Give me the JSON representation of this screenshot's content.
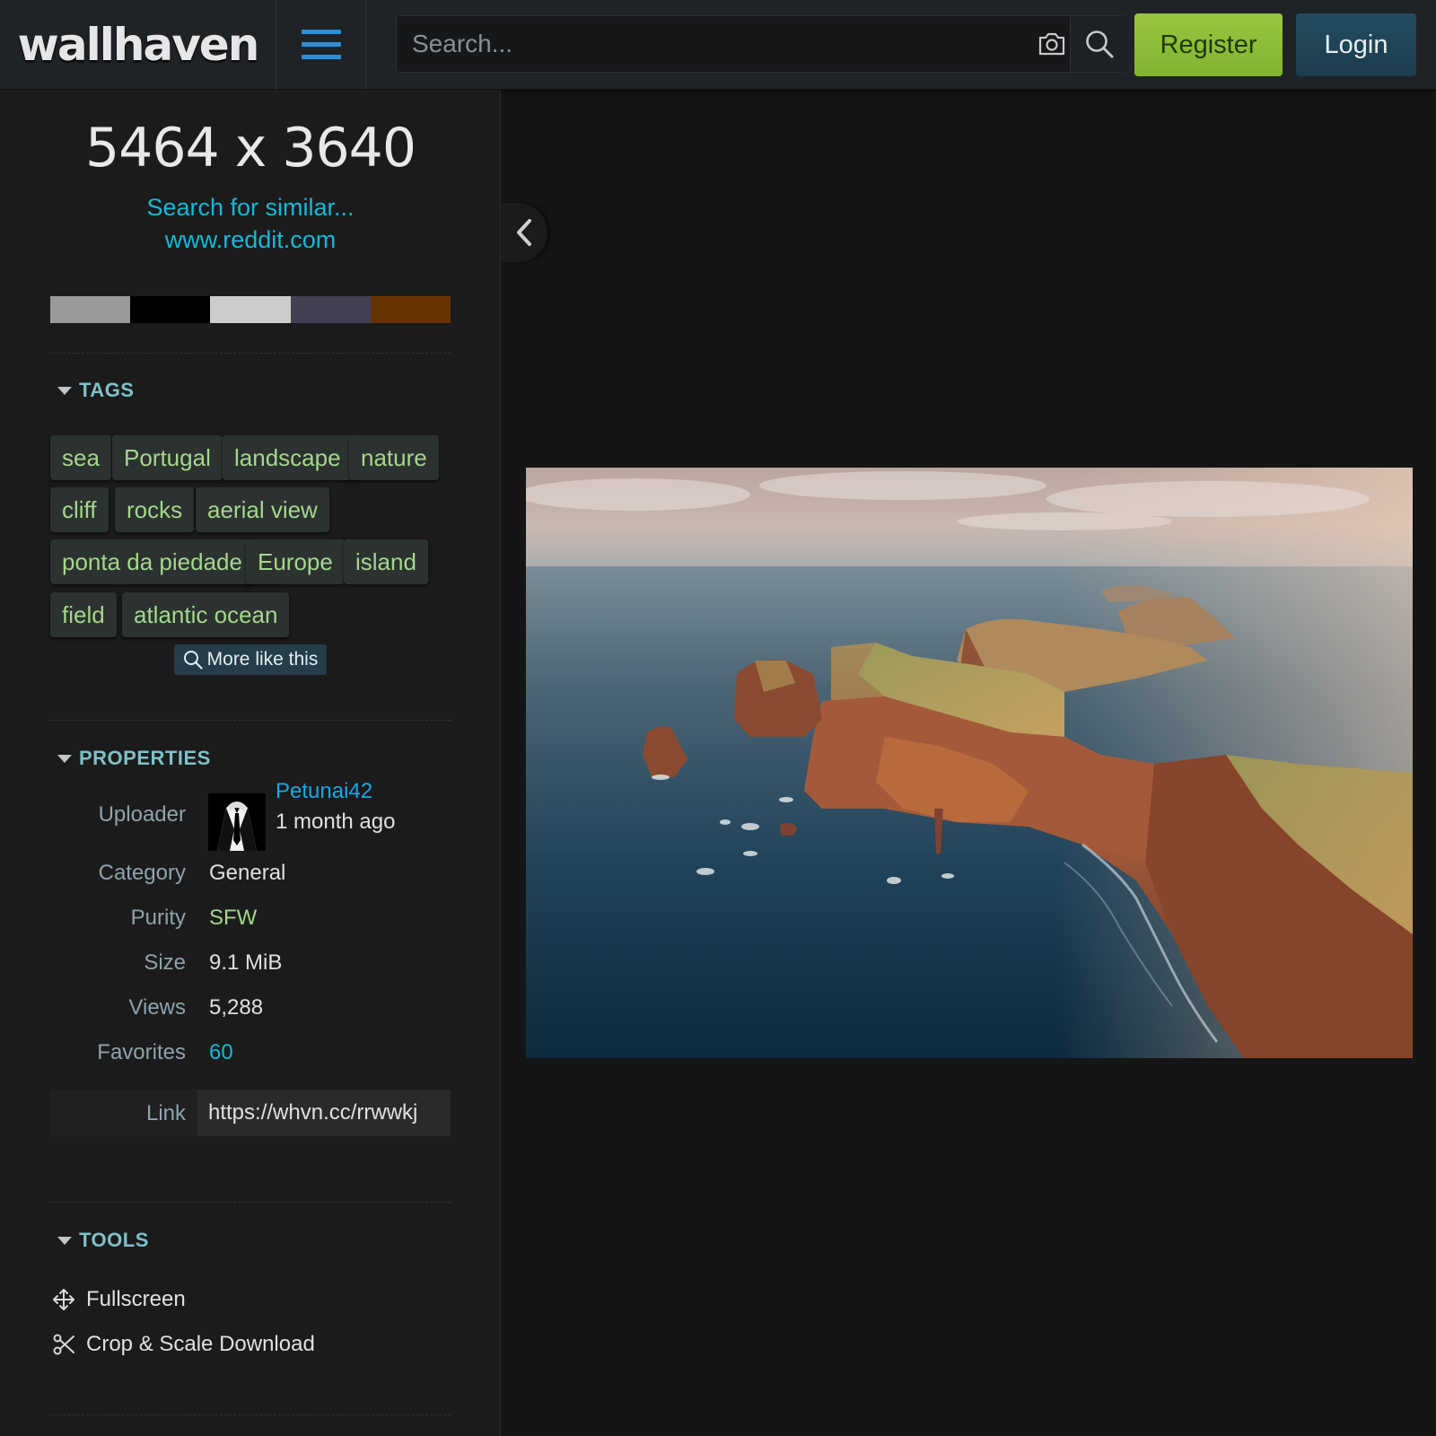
{
  "header": {
    "logo_text": "wallhaven",
    "search_placeholder": "Search...",
    "register_label": "Register",
    "login_label": "Login"
  },
  "sidebar": {
    "resolution": "5464 x 3640",
    "search_similar": "Search for similar...",
    "source_link": "www.reddit.com",
    "palette": [
      "#999999",
      "#000000",
      "#cccccc",
      "#424153",
      "#663300"
    ],
    "tags_title": "TAGS",
    "tags": [
      "sea",
      "Portugal",
      "landscape",
      "nature",
      "cliff",
      "rocks",
      "aerial view",
      "ponta da piedade",
      "Europe",
      "island",
      "field",
      "atlantic ocean"
    ],
    "more_like_this": "More like this",
    "properties_title": "PROPERTIES",
    "properties": {
      "uploader_label": "Uploader",
      "uploader_name": "Petunai42",
      "uploaded": "1 month ago",
      "category_label": "Category",
      "category": "General",
      "purity_label": "Purity",
      "purity": "SFW",
      "size_label": "Size",
      "size": "9.1 MiB",
      "views_label": "Views",
      "views": "5,288",
      "favorites_label": "Favorites",
      "favorites": "60",
      "link_label": "Link",
      "link": "https://whvn.cc/rrwwkj"
    },
    "tools_title": "TOOLS",
    "tools": {
      "fullscreen": "Fullscreen",
      "crop": "Crop & Scale Download"
    }
  },
  "colors": {
    "accent_link": "#13b9d8",
    "tag_text": "#a5d68c",
    "purity_sfw": "#a5d68c",
    "favorites": "#13b9d8",
    "uploader_name": "#1aa7e6",
    "register_bg": "#8cbb35",
    "login_bg": "#1f4456"
  }
}
